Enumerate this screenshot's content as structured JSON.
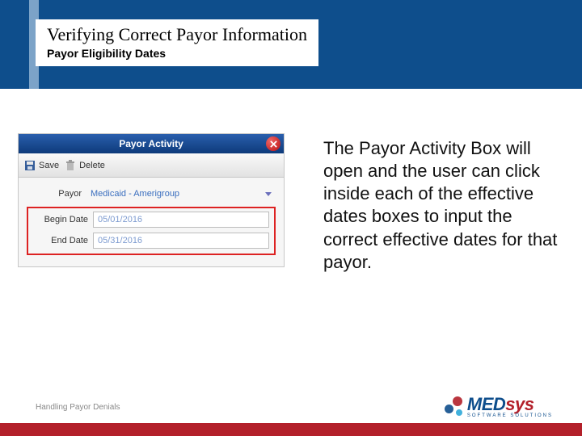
{
  "header": {
    "title": "Verifying Correct Payor Information",
    "subtitle": "Payor Eligibility Dates"
  },
  "screenshot": {
    "bar_title": "Payor Activity",
    "toolbar": {
      "save": "Save",
      "delete": "Delete"
    },
    "fields": {
      "payor_label": "Payor",
      "payor_value": "Medicaid - Amerigroup",
      "begin_label": "Begin Date",
      "begin_value": "05/01/2016",
      "end_label": "End Date",
      "end_value": "05/31/2016"
    }
  },
  "body_text": "The Payor Activity Box will open and the user can click inside each of the effective dates boxes to input the correct effective dates for that payor.",
  "footer": "Handling Payor Denials",
  "logo": {
    "part1": "MED",
    "part2": "sys",
    "tagline": "SOFTWARE SOLUTIONS"
  }
}
